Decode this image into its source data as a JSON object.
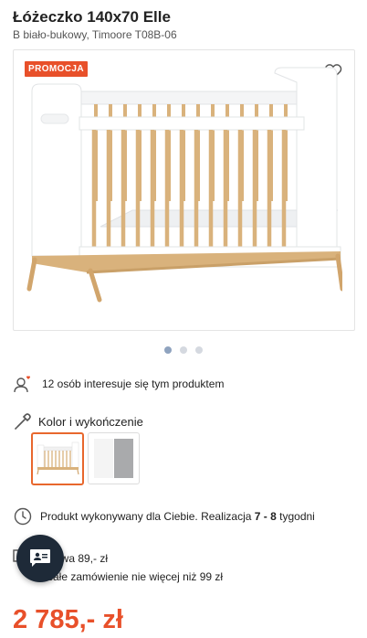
{
  "product": {
    "title": "Łóżeczko 140x70 Elle",
    "subtitle": "B biało-bukowy, Timoore T08B-06",
    "promo_badge": "PROMOCJA",
    "price": "2 785,- zł"
  },
  "gallery": {
    "count": 3,
    "active_index": 0
  },
  "interest": {
    "text": "12 osób interesuje się tym produktem"
  },
  "color_section": {
    "label": "Kolor i wykończenie",
    "options": [
      "white-beech",
      "white-grey"
    ],
    "selected_index": 0
  },
  "delivery": {
    "text_before": "Produkt wykonywany dla Ciebie. Realizacja ",
    "range": "7 - 8",
    "text_after": " tygodni"
  },
  "shipping": {
    "line1": "awa 89,- zł",
    "line2": "całe zamówienie nie więcej niż 99 zł"
  },
  "colors": {
    "accent": "#e8502a",
    "chat": "#1e2a38",
    "wood": "#d9b27c"
  }
}
